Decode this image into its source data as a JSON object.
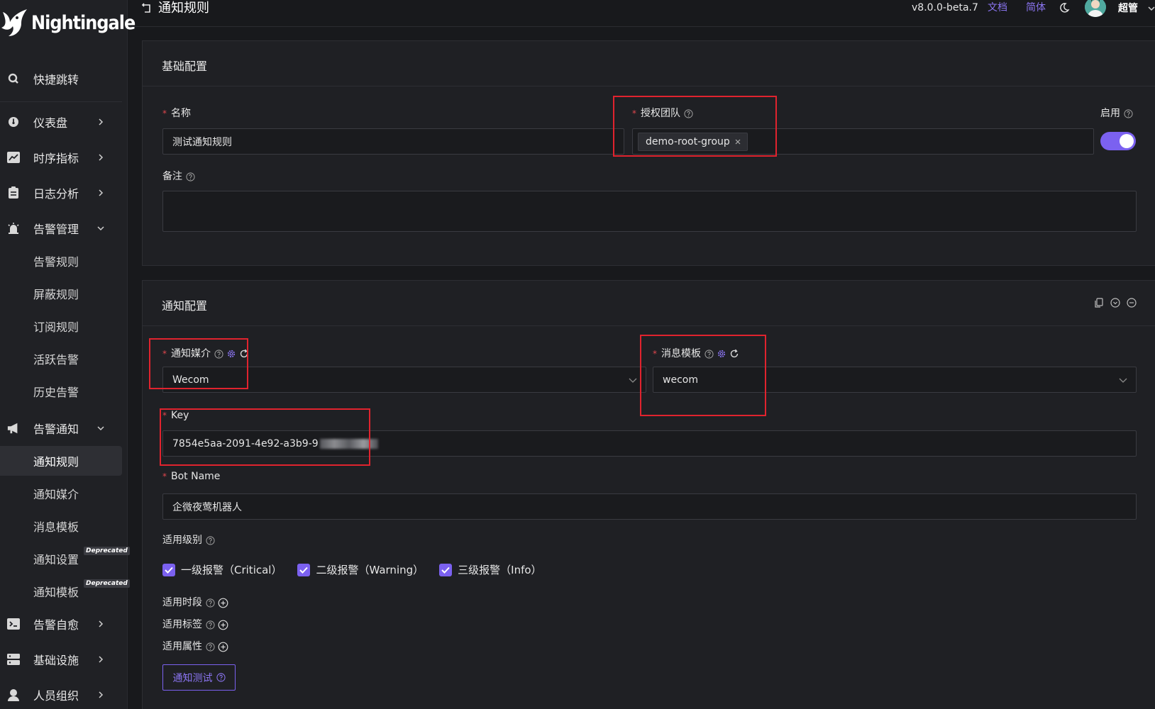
{
  "app": {
    "logo_text": "Nightingale",
    "version": "v8.0.0-beta.7",
    "docs_link": "文档",
    "lang_link": "简体",
    "user_name": "超管",
    "accent_color": "#7b61f0",
    "required_color": "#e0464e",
    "highlight_box_color": "#e0232e"
  },
  "page": {
    "title": "通知规则"
  },
  "sidebar": {
    "quick_jump": "快捷跳转",
    "groups": [
      {
        "label": "仪表盘",
        "icon": "dashboard-icon"
      },
      {
        "label": "时序指标",
        "icon": "line-chart-icon"
      },
      {
        "label": "日志分析",
        "icon": "log-icon"
      },
      {
        "label": "告警管理",
        "icon": "alarm-bell-icon"
      },
      {
        "label": "告警通知",
        "icon": "megaphone-icon"
      },
      {
        "label": "告警自愈",
        "icon": "terminal-icon"
      },
      {
        "label": "基础设施",
        "icon": "server-icon"
      },
      {
        "label": "人员组织",
        "icon": "user-icon"
      }
    ],
    "alert_mgmt_items": [
      "告警规则",
      "屏蔽规则",
      "订阅规则",
      "活跃告警",
      "历史告警"
    ],
    "alert_notify_items": [
      "通知规则",
      "通知媒介",
      "消息模板",
      "通知设置",
      "通知模板"
    ],
    "deprecated_badge": "Deprecated"
  },
  "basic": {
    "section_title": "基础配置",
    "name_label": "名称",
    "name_value": "测试通知规则",
    "team_label": "授权团队",
    "team_tag": "demo-root-group",
    "enable_label": "启用",
    "enabled": true,
    "note_label": "备注",
    "note_value": ""
  },
  "notify": {
    "section_title": "通知配置",
    "media_label": "通知媒介",
    "media_value": "Wecom",
    "template_label": "消息模板",
    "template_value": "wecom",
    "key_label": "Key",
    "key_value": "7854e5aa-2091-4e92-a3b9-9",
    "bot_label": "Bot Name",
    "bot_value": "企微夜莺机器人",
    "level_label": "适用级别",
    "levels": [
      {
        "label": "一级报警（Critical）",
        "checked": true
      },
      {
        "label": "二级报警（Warning）",
        "checked": true
      },
      {
        "label": "三级报警（Info）",
        "checked": true
      }
    ],
    "time_label": "适用时段",
    "tags_label": "适用标签",
    "attrs_label": "适用属性",
    "test_button": "通知测试"
  }
}
